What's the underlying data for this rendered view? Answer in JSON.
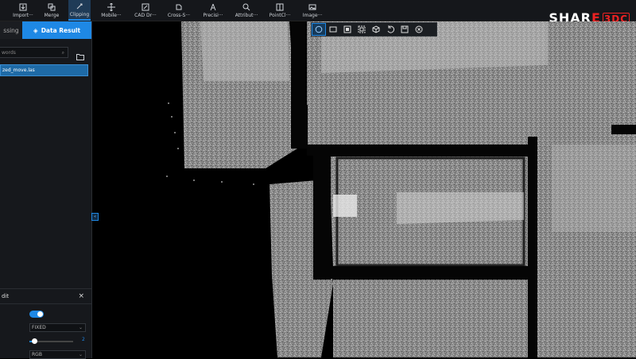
{
  "toolbar": {
    "items": [
      {
        "label": "Import···",
        "icon": "import-icon"
      },
      {
        "label": "Merge",
        "icon": "merge-icon"
      },
      {
        "label": "Clipping",
        "icon": "clipping-icon",
        "active": true
      },
      {
        "label": "Mobile···",
        "icon": "mobile-icon"
      },
      {
        "label": "CAD Dr···",
        "icon": "cad-drawing-icon"
      },
      {
        "label": "Cross-S···",
        "icon": "cross-section-icon"
      },
      {
        "label": "Precisi···",
        "icon": "precision-icon"
      },
      {
        "label": "Attribut···",
        "icon": "attribute-icon"
      },
      {
        "label": "PointCl···",
        "icon": "pointcloud-icon"
      },
      {
        "label": "Image···",
        "icon": "image-icon"
      }
    ],
    "accent_color": "#1e88e5"
  },
  "logo": {
    "text_main": "SHAR",
    "text_accent": "E",
    "text_tail": "3DC",
    "accent_color": "#e22222"
  },
  "left_panel": {
    "tab_inactive": "ssing",
    "tab_active": "Data Result",
    "search_placeholder": "words",
    "file_item": "zed_move.las"
  },
  "edit_panel": {
    "title": "dit",
    "close": "×",
    "mode_select": "FIXED",
    "slider_value": "2",
    "color_select": "RGB"
  },
  "collapse_label": "«",
  "viewport_controls": [
    {
      "icon": "lasso-circle-icon",
      "active": true
    },
    {
      "icon": "rectangle-select-icon"
    },
    {
      "icon": "polygon-select-icon"
    },
    {
      "icon": "box-select-icon"
    },
    {
      "icon": "cube-icon"
    },
    {
      "icon": "undo-icon"
    },
    {
      "icon": "save-icon"
    },
    {
      "icon": "close-circle-icon"
    }
  ]
}
